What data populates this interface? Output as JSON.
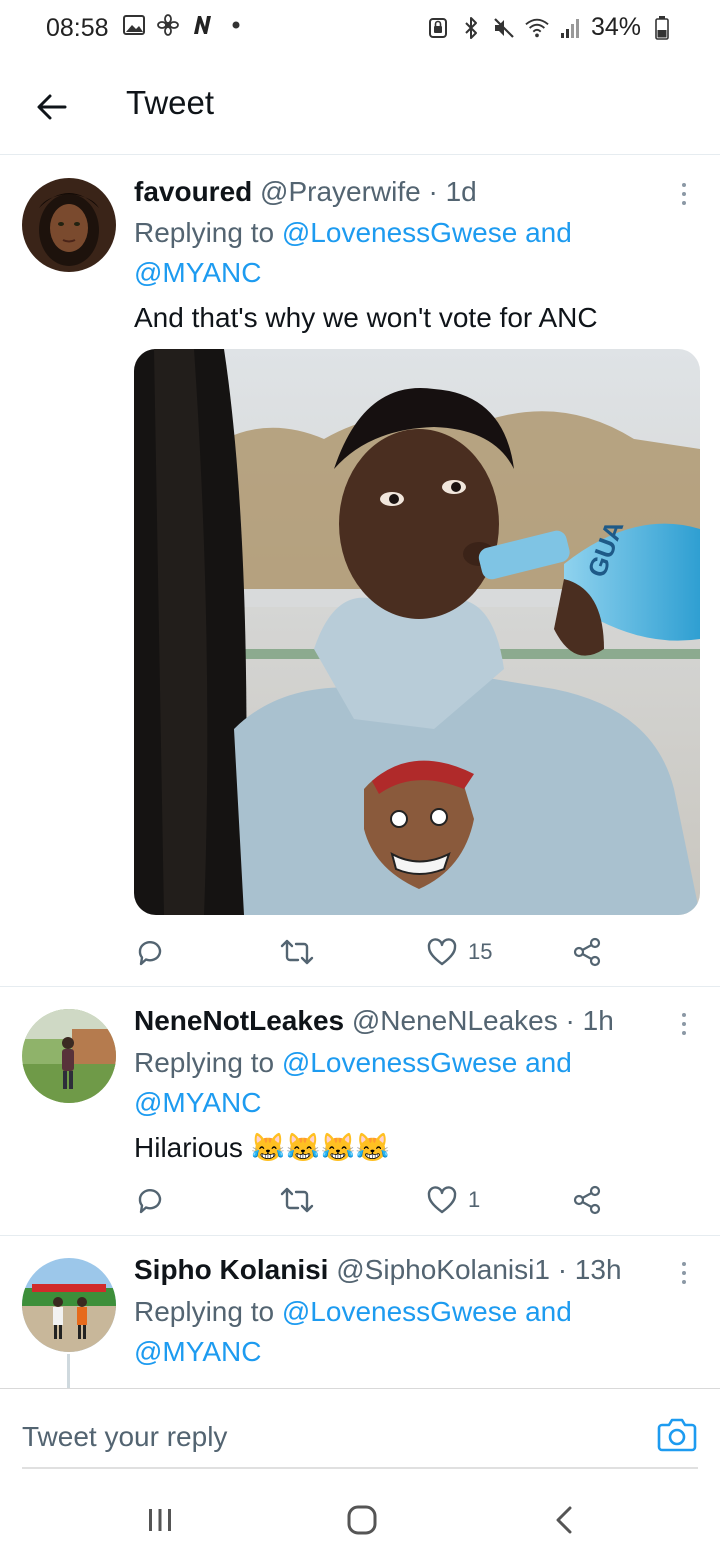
{
  "status_bar": {
    "time": "08:58",
    "battery": "34%",
    "icons_left": [
      "gallery-icon",
      "fan-icon",
      "n-icon",
      "dot-icon"
    ],
    "icons_right": [
      "lock-icon",
      "bluetooth-icon",
      "mute-icon",
      "wifi-icon",
      "signal-icon",
      "battery-icon"
    ]
  },
  "header": {
    "title": "Tweet"
  },
  "tweets": [
    {
      "name": "favoured",
      "handle": "@Prayerwife",
      "time": "· 1d",
      "replying_prefix": "Replying to ",
      "replying_to_1": "@LovenessGwese",
      "replying_and": " and",
      "replying_to_2": "@MYANC",
      "text": "And that's why we won't vote for ANC",
      "likes": "15",
      "media_text": "GUA"
    },
    {
      "name": "NeneNotLeakes",
      "handle": "@NeneNLeakes",
      "time": "· 1h",
      "replying_prefix": "Replying to ",
      "replying_to_1": "@LovenessGwese",
      "replying_and": " and",
      "replying_to_2": "@MYANC",
      "text": "Hilarious",
      "emoji": "😹😹😹😹",
      "likes": "1"
    },
    {
      "name": "Sipho Kolanisi",
      "handle": "@SiphoKolanisi1",
      "time": "· 13h",
      "replying_prefix": "Replying to ",
      "replying_to_1": "@LovenessGwese",
      "replying_and": " and",
      "replying_to_2": "@MYANC"
    }
  ],
  "reply_bar": {
    "placeholder": "Tweet your reply"
  },
  "colors": {
    "link": "#1d9bf0",
    "secondary": "#536471",
    "divider": "#e6ecf0"
  }
}
